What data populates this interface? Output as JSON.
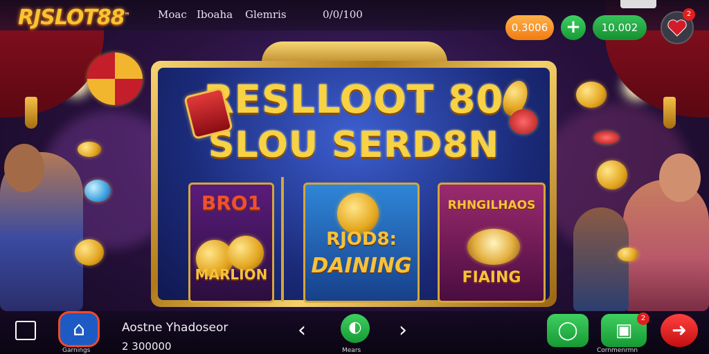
{
  "header": {
    "logo": "RJSLOT88",
    "logo_mark": "™",
    "nav": [
      "Moac",
      "Iboaha",
      "Glemris",
      "0/0/100"
    ]
  },
  "balances": {
    "primary": "0.3006",
    "secondary": "10.002",
    "add_label": "+",
    "notification_count": "2"
  },
  "banner": {
    "title_line1": "RESLLOOT 80",
    "title_line2": "SLOU SERD8N",
    "cards": [
      {
        "top": "BRO1",
        "bottom": "MARLION"
      },
      {
        "top": "RJOD8:",
        "bottom": "DAINING"
      },
      {
        "top": "RHNGILHAOS",
        "bottom": "FIAING"
      }
    ]
  },
  "footer": {
    "home_label": "Garnings",
    "player_name": "Aostne Yhadoseor",
    "player_amount": "2 300000",
    "center_label": "Mears",
    "right_label": "Cornmenrmn",
    "right_badge": "2",
    "prev_icon": "chevron-left",
    "next_icon": "chevron-right"
  },
  "colors": {
    "gold": "#f7d244",
    "green": "#1fae43",
    "orange": "#f39422",
    "red": "#e02020"
  }
}
